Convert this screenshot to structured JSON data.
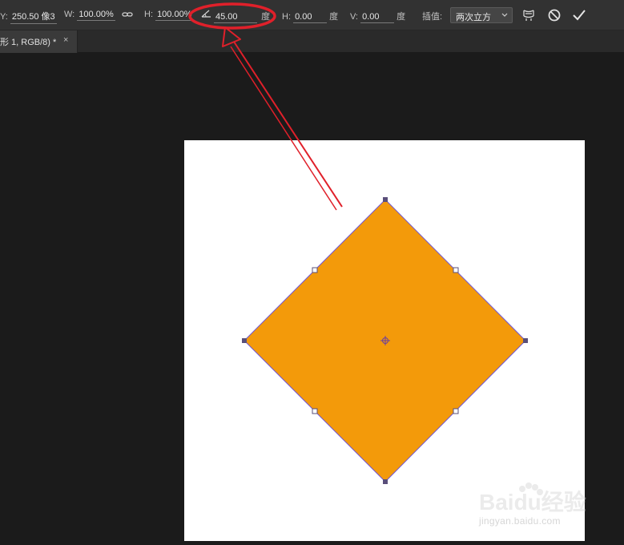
{
  "options_bar": {
    "y_label": "Y:",
    "y_value": "250.50 像3",
    "w_label": "W:",
    "w_value": "100.00%",
    "h_label": "H:",
    "h_value": "100.00%",
    "angle_value": "45.00",
    "angle_unit": "度",
    "skew_h_label": "H:",
    "skew_h_value": "0.00",
    "skew_h_unit": "度",
    "skew_v_label": "V:",
    "skew_v_value": "0.00",
    "skew_v_unit": "度",
    "interp_label": "插值:",
    "interp_value": "两次立方"
  },
  "document_tab": {
    "title": "形 1, RGB/8) *",
    "close_glyph": "×"
  },
  "watermark": {
    "brand": "Baidu经验",
    "url": "jingyan.baidu.com"
  },
  "colors": {
    "shape_fill": "#f39a0a",
    "annotation_red": "#e0202a",
    "path_outline": "#6f55d6"
  },
  "icons": [
    "link-icon",
    "angle-icon",
    "chevron-down-icon",
    "warp-icon",
    "cancel-icon",
    "commit-icon",
    "center-point-icon"
  ]
}
